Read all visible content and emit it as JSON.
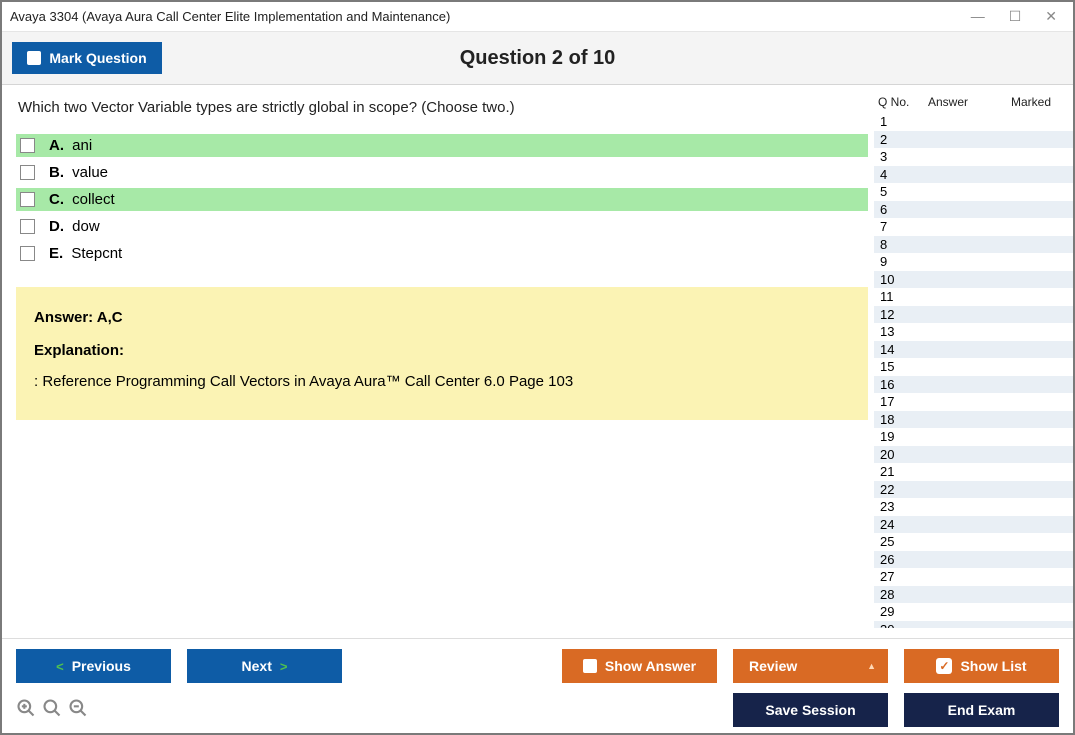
{
  "window": {
    "title": "Avaya 3304 (Avaya Aura Call Center Elite Implementation and Maintenance)"
  },
  "header": {
    "mark_label": "Mark Question",
    "counter": "Question 2 of 10"
  },
  "question": {
    "text": "Which two Vector Variable types are strictly global in scope? (Choose two.)",
    "options": [
      {
        "letter": "A.",
        "text": "ani",
        "correct": true
      },
      {
        "letter": "B.",
        "text": "value",
        "correct": false
      },
      {
        "letter": "C.",
        "text": "collect",
        "correct": true
      },
      {
        "letter": "D.",
        "text": "dow",
        "correct": false
      },
      {
        "letter": "E.",
        "text": "Stepcnt",
        "correct": false
      }
    ]
  },
  "explanation": {
    "answer_label": "Answer: A,C",
    "title": "Explanation:",
    "text": ": Reference Programming Call Vectors in Avaya Aura™ Call Center 6.0 Page 103"
  },
  "sidebar": {
    "headers": {
      "q": "Q No.",
      "a": "Answer",
      "m": "Marked"
    },
    "count": 30
  },
  "footer": {
    "previous": "Previous",
    "next": "Next",
    "show_answer": "Show Answer",
    "review": "Review",
    "show_list": "Show List",
    "save_session": "Save Session",
    "end_exam": "End Exam"
  }
}
